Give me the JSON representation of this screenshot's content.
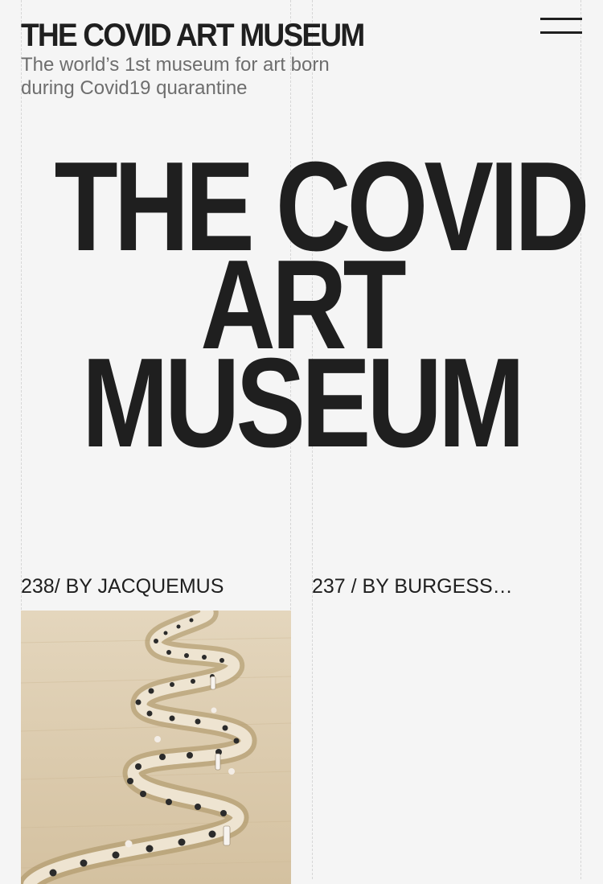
{
  "header": {
    "logo": "THE COVID ART MUSEUM",
    "tagline": "The world’s 1st museum for art born during Covid19 quarantine",
    "menu_icon": "hamburger-menu-icon"
  },
  "hero": {
    "lines": [
      "THE COVID",
      "ART",
      "MUSEUM"
    ]
  },
  "cards": [
    {
      "title": "238/ BY JACQUEMUS",
      "image_icon": "wheat-field-runway-photo"
    },
    {
      "title": "237 / BY BURGESS_J..."
    }
  ]
}
